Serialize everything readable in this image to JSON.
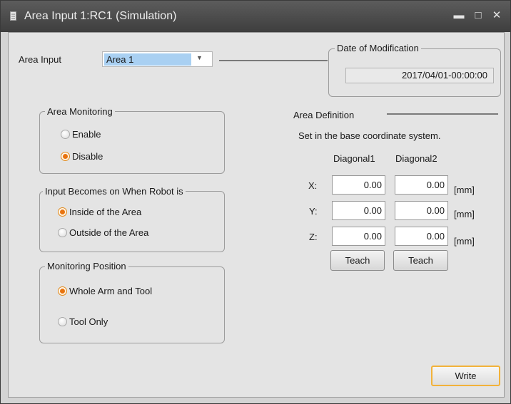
{
  "window": {
    "title": "Area Input 1:RC1 (Simulation)",
    "controls": {
      "minimize": "▬",
      "maximize": "□",
      "close": "✕"
    }
  },
  "area_input": {
    "label": "Area Input",
    "selected": "Area 1"
  },
  "date_of_modification": {
    "legend": "Date of Modification",
    "value": "2017/04/01-00:00:00"
  },
  "area_monitoring": {
    "legend": "Area Monitoring",
    "options": [
      {
        "label": "Enable",
        "selected": false
      },
      {
        "label": "Disable",
        "selected": true
      }
    ]
  },
  "input_becomes_on": {
    "legend": "Input Becomes on When Robot is",
    "options": [
      {
        "label": "Inside of the Area",
        "selected": true
      },
      {
        "label": "Outside of the Area",
        "selected": false
      }
    ]
  },
  "monitoring_position": {
    "legend": "Monitoring Position",
    "options": [
      {
        "label": "Whole Arm and Tool",
        "selected": true
      },
      {
        "label": "Tool Only",
        "selected": false
      }
    ]
  },
  "area_definition": {
    "title": "Area Definition",
    "note": "Set in the base coordinate system.",
    "col1": "Diagonal1",
    "col2": "Diagonal2",
    "rows": [
      {
        "axis": "X:",
        "d1": "0.00",
        "d2": "0.00",
        "unit": "[mm]"
      },
      {
        "axis": "Y:",
        "d1": "0.00",
        "d2": "0.00",
        "unit": "[mm]"
      },
      {
        "axis": "Z:",
        "d1": "0.00",
        "d2": "0.00",
        "unit": "[mm]"
      }
    ],
    "teach1": "Teach",
    "teach2": "Teach"
  },
  "write_button": "Write",
  "colors": {
    "accent_orange": "#e8730f",
    "selection_blue": "#a9d0f2",
    "titlebar": "#4a4a4a"
  }
}
